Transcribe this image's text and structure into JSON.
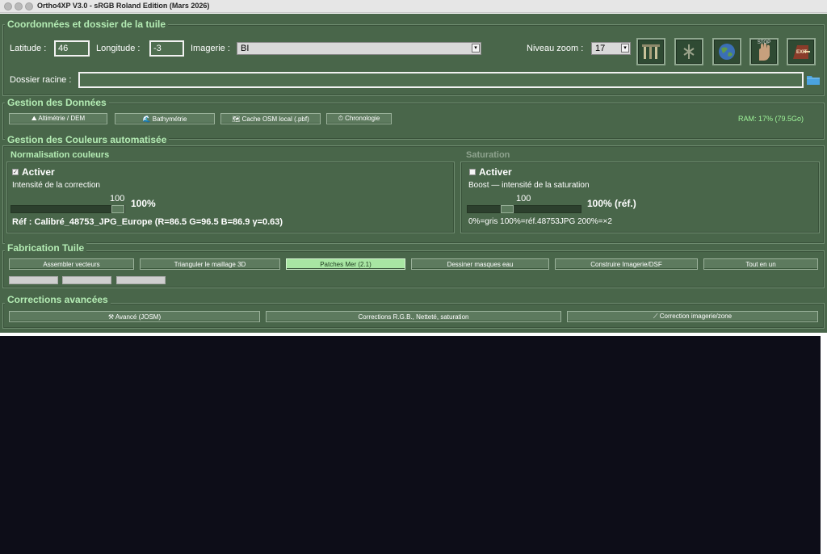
{
  "window": {
    "title": "Ortho4XP V3.0 - sRGB Roland Edition (Mars 2026)"
  },
  "tile": {
    "section_title": "Coordonnées et dossier de la tuile",
    "latitude_label": "Latitude :",
    "latitude_value": "46",
    "longitude_label": "Longitude :",
    "longitude_value": "-3",
    "imagery_label": "Imagerie :",
    "imagery_value": "BI",
    "zoom_label": "Niveau zoom :",
    "zoom_value": "17",
    "root_label": "Dossier racine :",
    "root_value": "",
    "tools": [
      {
        "name": "tools-icon"
      },
      {
        "name": "config-icon"
      },
      {
        "name": "globe-icon"
      },
      {
        "name": "stop-icon",
        "text": "STOP"
      },
      {
        "name": "exit-icon",
        "text": "EXIT"
      }
    ]
  },
  "data_mgmt": {
    "section_title": "Gestion des Données",
    "buttons": [
      "⛰ Altimétrie / DEM",
      "🌊 Bathymétrie",
      "🗺 Cache OSM local (.pbf)",
      "⏱ Chronologie"
    ],
    "ram_status": "RAM: 17%  (79.5Go)"
  },
  "colors": {
    "section_title": "Gestion des Couleurs automatisée",
    "normalize": {
      "title": "Normalisation couleurs",
      "activate_label": "Activer",
      "activate_checked": "✓",
      "intensity_label": "Intensité de la correction",
      "slider_value": "100",
      "slider_fraction": 1.0,
      "percent_text": "100%",
      "ref_text": "Réf : Calibré_48753_JPG_Europe (R=86.5 G=96.5 B=86.9 γ=0.63)"
    },
    "saturation": {
      "title": "Saturation",
      "activate_label": "Activer",
      "boost_label": "Boost — intensité de la saturation",
      "slider_value": "100",
      "slider_fraction": 0.33,
      "percent_text": "100%  (réf.)",
      "scale_text": "0%=gris  100%=réf.48753JPG  200%=×2"
    }
  },
  "build": {
    "section_title": "Fabrication Tuile",
    "buttons": [
      "Assembler vecteurs",
      "Trianguler le maillage 3D",
      "Patches Mer (2.1)",
      "Dessiner masques eau",
      "Construire Imagerie/DSF",
      "Tout en un"
    ]
  },
  "advanced": {
    "section_title": "Corrections avancées",
    "buttons": [
      "⚒ Avancé (JOSM)",
      "Corrections R.G.B., Netteté, saturation",
      "⟋ Correction imagerie/zone"
    ]
  },
  "colors_theme": {
    "bg": "#49664a",
    "accent": "#b4ecb4",
    "active_button": "#a8e6a3",
    "console": "#0d0d18"
  }
}
